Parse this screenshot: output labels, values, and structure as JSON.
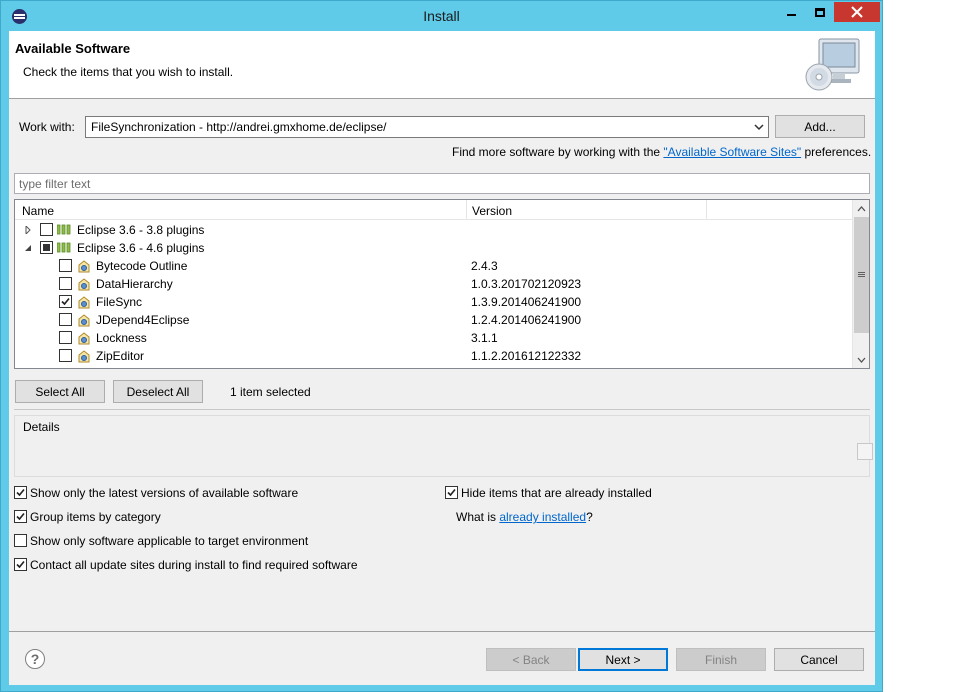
{
  "window": {
    "title": "Install"
  },
  "header": {
    "title": "Available Software",
    "subtitle": "Check the items that you wish to install."
  },
  "work_with": {
    "label": "Work with:",
    "value": "FileSynchronization - http://andrei.gmxhome.de/eclipse/",
    "add_button": "Add..."
  },
  "find_more": {
    "prefix": "Find more software by working with the ",
    "link": "\"Available Software Sites\"",
    "suffix": " preferences."
  },
  "filter": {
    "placeholder": "type filter text"
  },
  "tree": {
    "columns": [
      "Name",
      "Version"
    ],
    "categories": [
      {
        "name": "Eclipse 3.6 - 3.8 plugins",
        "expanded": false,
        "state": "unchecked"
      },
      {
        "name": "Eclipse 3.6 - 4.6 plugins",
        "expanded": true,
        "state": "partial"
      }
    ],
    "items": [
      {
        "name": "Bytecode Outline",
        "version": "2.4.3",
        "checked": false
      },
      {
        "name": "DataHierarchy",
        "version": "1.0.3.201702120923",
        "checked": false
      },
      {
        "name": "FileSync",
        "version": "1.3.9.201406241900",
        "checked": true
      },
      {
        "name": "JDepend4Eclipse",
        "version": "1.2.4.201406241900",
        "checked": false
      },
      {
        "name": "Lockness",
        "version": "3.1.1",
        "checked": false
      },
      {
        "name": "ZipEditor",
        "version": "1.1.2.201612122332",
        "checked": false
      }
    ]
  },
  "selection": {
    "select_all": "Select All",
    "deselect_all": "Deselect All",
    "status": "1 item selected"
  },
  "details": {
    "label": "Details"
  },
  "options": {
    "latest_versions": {
      "label": "Show only the latest versions of available software",
      "checked": true
    },
    "group_by_category": {
      "label": "Group items by category",
      "checked": true
    },
    "target_env": {
      "label": "Show only software applicable to target environment",
      "checked": false
    },
    "contact_sites": {
      "label": "Contact all update sites during install to find required software",
      "checked": true
    },
    "hide_installed": {
      "label": "Hide items that are already installed",
      "checked": true
    },
    "what_is_prefix": "What is ",
    "what_is_link": "already installed",
    "what_is_suffix": "?"
  },
  "buttons": {
    "back": "< Back",
    "next": "Next >",
    "finish": "Finish",
    "cancel": "Cancel"
  },
  "colors": {
    "titlebar": "#5fcbe9",
    "close": "#c7372f",
    "link": "#0066cc",
    "default_border": "#0078d7"
  },
  "icons": [
    "eclipse-app-icon",
    "minimize-icon",
    "maximize-icon",
    "close-icon",
    "install-monitor-icon",
    "dropdown-arrow-icon",
    "category-icon",
    "plugin-icon",
    "help-icon"
  ]
}
